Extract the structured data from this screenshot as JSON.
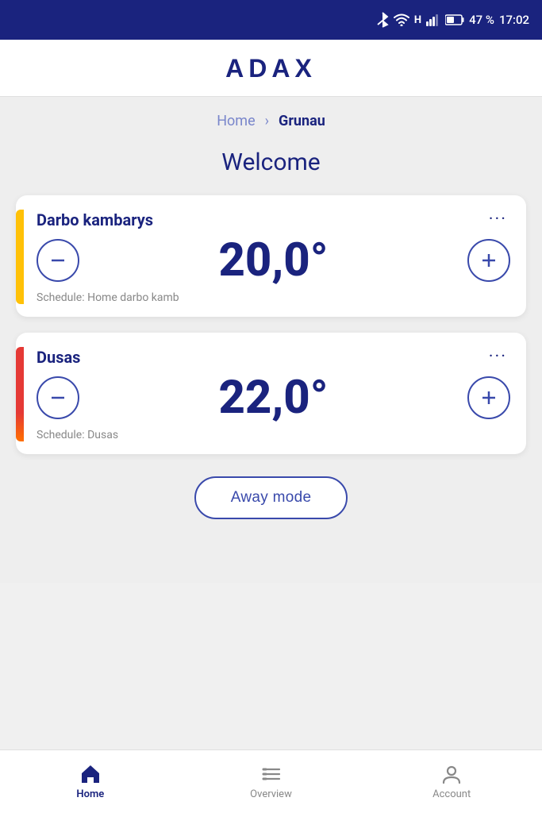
{
  "statusBar": {
    "battery": "47 %",
    "time": "17:02"
  },
  "header": {
    "logo": "ADAX"
  },
  "breadcrumb": {
    "home_label": "Home",
    "current_label": "Grunau"
  },
  "welcome": {
    "text": "Welcome"
  },
  "cards": [
    {
      "id": "card-1",
      "title": "Darbo kambarys",
      "temperature": "20,0°",
      "schedule": "Schedule: Home darbo kamb",
      "accent_color": "yellow"
    },
    {
      "id": "card-2",
      "title": "Dusas",
      "temperature": "22,0°",
      "schedule": "Schedule: Dusas",
      "accent_color": "red"
    }
  ],
  "awayMode": {
    "label": "Away mode"
  },
  "bottomNav": {
    "items": [
      {
        "label": "Home",
        "active": true
      },
      {
        "label": "Overview",
        "active": false
      },
      {
        "label": "Account",
        "active": false
      }
    ]
  }
}
